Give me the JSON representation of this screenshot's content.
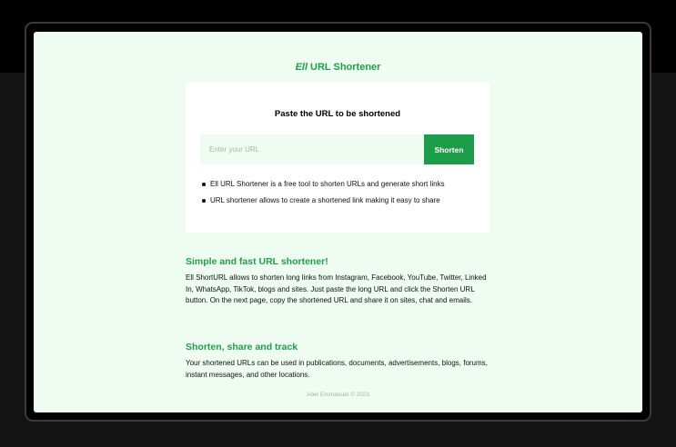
{
  "brand": {
    "mark": "Ell",
    "name": "URL Shortener"
  },
  "card": {
    "title": "Paste the URL to be shortened",
    "input_placeholder": "Enter your URL",
    "input_value": "",
    "button_label": "Shorten",
    "bullets": [
      "Ell URL Shortener is a free tool to shorten URLs and generate short links",
      "URL shortener allows to create a shortened link making it easy to share"
    ]
  },
  "sections": [
    {
      "heading": "Simple and fast URL shortener!",
      "body": "Ell ShortURL allows to shorten long links from Instagram, Facebook, YouTube, Twitter, Linked In, WhatsApp, TikTok, blogs and sites. Just paste the long URL and click the Shorten URL button. On the next page, copy the shortened URL and share it on sites, chat and emails."
    },
    {
      "heading": "Shorten, share and track",
      "body": "Your shortened URLs can be used in publications, documents, advertisements, blogs, forums, instant messages, and other locations."
    }
  ],
  "footer": {
    "text": "Abel Emmanuel © 2023"
  },
  "colors": {
    "accent": "#1f9e4b",
    "page_background": "#effcf1",
    "frame_background": "#131313"
  }
}
